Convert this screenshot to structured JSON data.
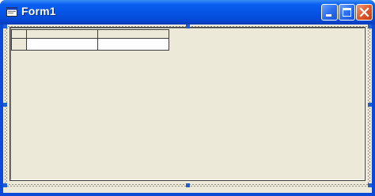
{
  "window": {
    "title": "Form1",
    "icon": "form-app-icon"
  },
  "controls": {
    "minimize_icon": "minimize-icon",
    "maximize_icon": "maximize-icon",
    "close_icon": "close-icon"
  },
  "grid": {
    "fixed_rows": 1,
    "fixed_cols": 1,
    "rows": 2,
    "cols": 3
  },
  "colors": {
    "titlebar": "#0553e4",
    "client": "#ece9d8",
    "selection_handle": "#1f5fd6",
    "close_button": "#e05a30"
  }
}
